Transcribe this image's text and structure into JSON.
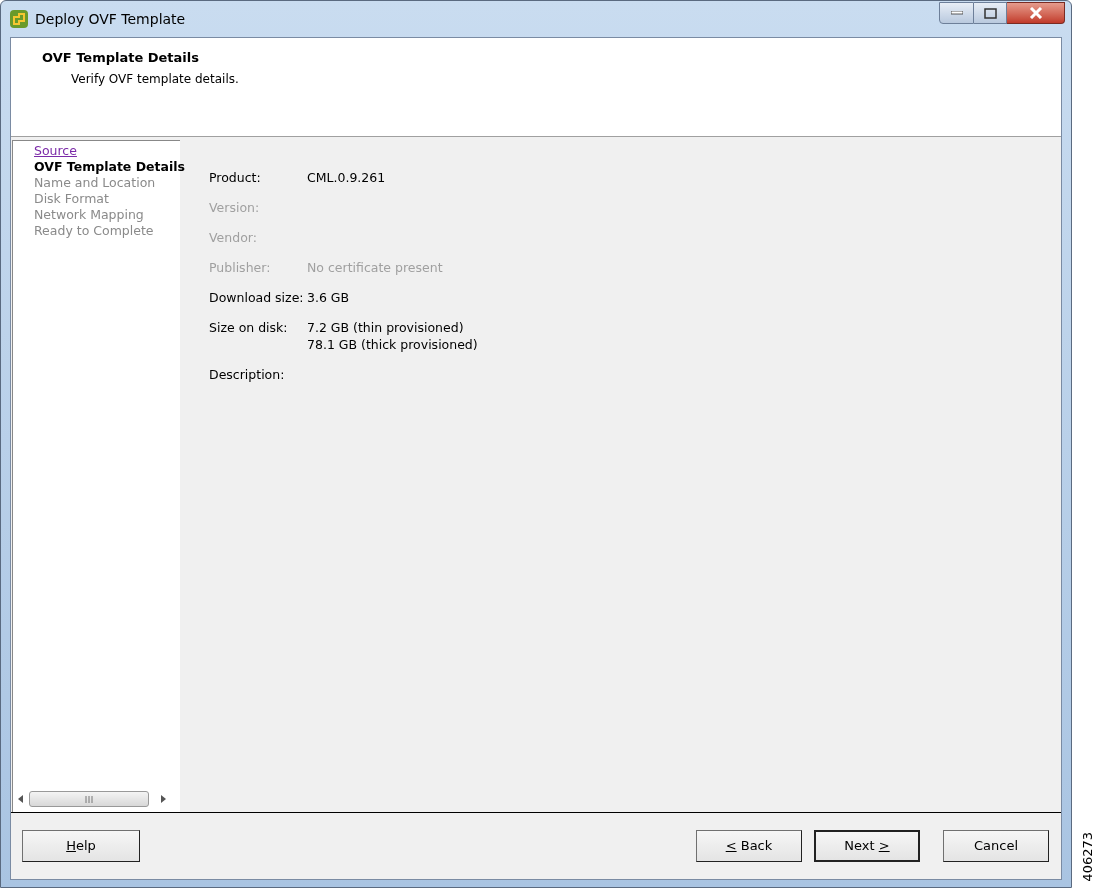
{
  "window": {
    "title": "Deploy OVF Template"
  },
  "header": {
    "title": "OVF Template Details",
    "subtitle": "Verify OVF template details."
  },
  "steps": [
    {
      "label": "Source",
      "kind": "link"
    },
    {
      "label": "OVF Template Details",
      "kind": "current"
    },
    {
      "label": "Name and Location",
      "kind": "pending"
    },
    {
      "label": "Disk Format",
      "kind": "pending"
    },
    {
      "label": "Network Mapping",
      "kind": "pending"
    },
    {
      "label": "Ready to Complete",
      "kind": "pending"
    }
  ],
  "details": [
    {
      "label": "Product:",
      "values": [
        "CML.0.9.261"
      ],
      "disabled": false
    },
    {
      "label": "Version:",
      "disabled": true
    },
    {
      "label": "Vendor:",
      "disabled": true
    },
    {
      "label": "Publisher:",
      "values": [
        "No certificate present"
      ],
      "disabled": true
    },
    {
      "label": "Download size:",
      "values": [
        "3.6 GB"
      ],
      "disabled": false
    },
    {
      "label": "Size on disk:",
      "values": [
        "7.2 GB (thin provisioned)",
        "78.1 GB (thick provisioned)"
      ],
      "disabled": false
    },
    {
      "label": "Description:",
      "disabled": false
    }
  ],
  "buttons": [
    {
      "label": {
        "key": "H",
        "after": "elp"
      },
      "default": false
    },
    {
      "label": {
        "key": "<",
        "after": " Back"
      },
      "default": false
    },
    {
      "label": {
        "before": "Next ",
        "key": ">"
      },
      "default": true
    },
    {
      "label": {
        "before": "Cancel"
      },
      "default": false
    }
  ],
  "figure_number": "406273"
}
